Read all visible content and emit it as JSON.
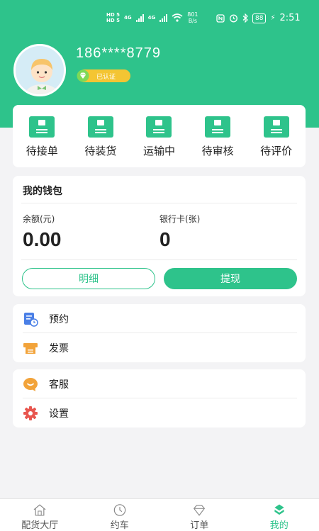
{
  "status_bar": {
    "hd1": "HD 5",
    "hd2": "HD 5",
    "net1": "4G",
    "net2": "4G",
    "speed_value": "801",
    "speed_unit": "B/s",
    "battery": "88",
    "time": "2:51"
  },
  "profile": {
    "phone": "186****8779",
    "verified_label": "已认证"
  },
  "orders": {
    "items": [
      {
        "label": "待接单"
      },
      {
        "label": "待装货"
      },
      {
        "label": "运输中"
      },
      {
        "label": "待审核"
      },
      {
        "label": "待评价"
      }
    ]
  },
  "wallet": {
    "title": "我的钱包",
    "balance_label": "余额(元)",
    "balance_value": "0.00",
    "cards_label": "银行卡(张)",
    "cards_value": "0",
    "detail_button": "明细",
    "withdraw_button": "提现"
  },
  "menu1": {
    "items": [
      {
        "label": "预约",
        "icon": "calendar-clock-icon"
      },
      {
        "label": "发票",
        "icon": "invoice-icon"
      }
    ]
  },
  "menu2": {
    "items": [
      {
        "label": "客服",
        "icon": "chat-bubble-icon"
      },
      {
        "label": "设置",
        "icon": "gear-icon"
      }
    ]
  },
  "tabbar": {
    "items": [
      {
        "label": "配货大厅",
        "icon": "home-icon"
      },
      {
        "label": "约车",
        "icon": "clock-icon"
      },
      {
        "label": "订单",
        "icon": "diamond-icon"
      },
      {
        "label": "我的",
        "icon": "profile-icon",
        "active": true
      }
    ]
  },
  "colors": {
    "accent": "#2ec38b",
    "badge": "#f4c533",
    "calendar_icon": "#4a7fe6",
    "invoice_icon": "#f2a33a",
    "chat_icon": "#f2a33a",
    "gear_icon": "#e8564f"
  }
}
